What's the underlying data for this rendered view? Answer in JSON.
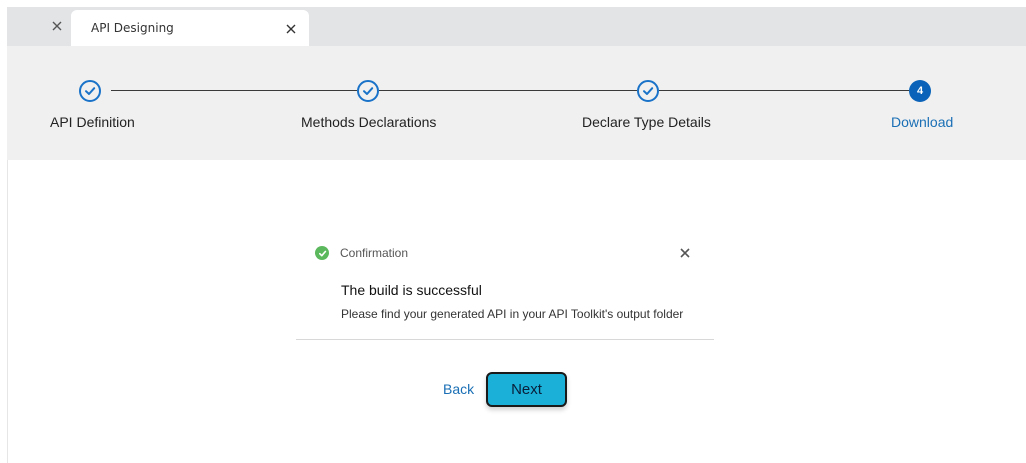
{
  "tabs": {
    "active_tab_label": "API Designing"
  },
  "stepper": {
    "steps": [
      {
        "label": "API Definition",
        "status": "complete"
      },
      {
        "label": "Methods Declarations",
        "status": "complete"
      },
      {
        "label": "Declare Type Details",
        "status": "complete"
      },
      {
        "label": "Download",
        "status": "active",
        "number": "4"
      }
    ]
  },
  "confirmation": {
    "title": "Confirmation",
    "heading": "The build is successful",
    "message": "Please find your generated API in your API Toolkit's output folder"
  },
  "actions": {
    "back_label": "Back",
    "next_label": "Next"
  },
  "colors": {
    "accent_blue": "#1a73c8",
    "next_button": "#1ab0d8",
    "success_green": "#5cb85c"
  },
  "icons": {
    "tabbar_close": "close-icon",
    "tab_close": "close-icon",
    "step_complete": "check-circle-icon",
    "confirmation": "check-circle-icon",
    "confirmation_close": "close-icon"
  }
}
